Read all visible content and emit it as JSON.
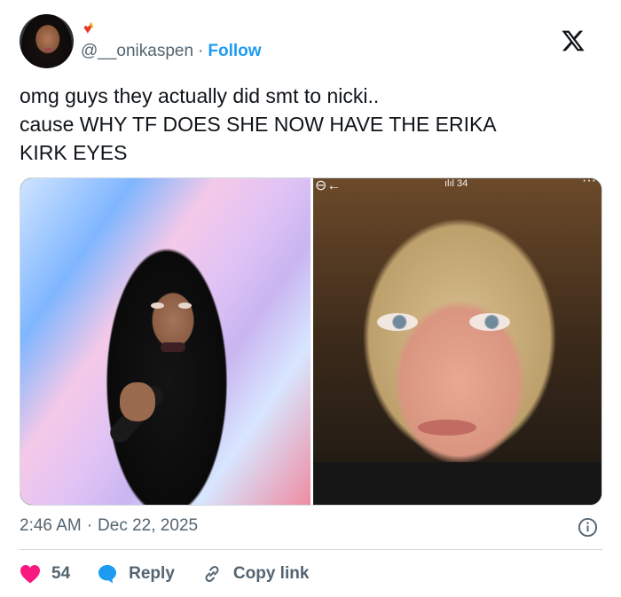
{
  "author": {
    "handle": "@__onikaspen",
    "follow_label": "Follow",
    "separator": "·",
    "badge_emoji": "❤️‍🔥"
  },
  "tweet": {
    "text": "omg guys they actually did smt to nicki..\ncause WHY TF DOES SHE NOW HAVE THE ERIKA\nKIRK EYES"
  },
  "media": {
    "right_overlay": {
      "status_text": "ılıl 34",
      "back_glyph": "⊖←",
      "more_glyph": "···"
    }
  },
  "meta": {
    "time": "2:46 AM",
    "separator": "·",
    "date": "Dec 22, 2025"
  },
  "actions": {
    "like_count": "54",
    "reply_label": "Reply",
    "copy_label": "Copy link"
  },
  "colors": {
    "accent": "#1d9bf0",
    "like": "#f91880",
    "reply": "#1d9bf0",
    "muted": "#536471",
    "text": "#0f1419"
  },
  "icons": {
    "brand": "x-logo-icon",
    "like": "heart-icon",
    "reply": "speech-bubble-icon",
    "copy": "link-icon",
    "info": "info-icon"
  }
}
